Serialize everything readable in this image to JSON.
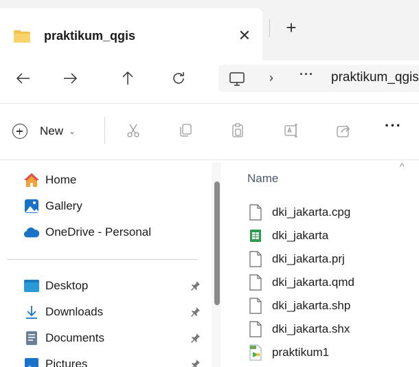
{
  "tab": {
    "title": "praktikum_qgis",
    "close_glyph": "✕",
    "new_tab_glyph": "+"
  },
  "nav": {
    "address_more": "···",
    "address_chevron": "›",
    "breadcrumb": "praktikum_qgis"
  },
  "commandbar": {
    "new_label": "New",
    "new_chevron": "⌄",
    "more_glyph": "···"
  },
  "sidebar": {
    "items": [
      {
        "label": "Home",
        "icon": "home-icon"
      },
      {
        "label": "Gallery",
        "icon": "gallery-icon"
      },
      {
        "label": "OneDrive - Personal",
        "icon": "onedrive-icon"
      },
      {
        "label": "Desktop",
        "icon": "desktop-icon"
      },
      {
        "label": "Downloads",
        "icon": "downloads-icon"
      },
      {
        "label": "Documents",
        "icon": "documents-icon"
      },
      {
        "label": "Pictures",
        "icon": "pictures-icon"
      }
    ]
  },
  "filelist": {
    "column_name": "Name",
    "sort_glyph": "^",
    "files": [
      {
        "name": "dki_jakarta.cpg",
        "icon": "file-icon"
      },
      {
        "name": "dki_jakarta",
        "icon": "spreadsheet-icon"
      },
      {
        "name": "dki_jakarta.prj",
        "icon": "file-icon"
      },
      {
        "name": "dki_jakarta.qmd",
        "icon": "file-icon"
      },
      {
        "name": "dki_jakarta.shp",
        "icon": "file-icon"
      },
      {
        "name": "dki_jakarta.shx",
        "icon": "file-icon"
      },
      {
        "name": "praktikum1",
        "icon": "qgis-project-icon"
      }
    ]
  },
  "colors": {
    "folder": "#f2c14e",
    "accent_blue": "#1a73c9",
    "spreadsheet_green": "#2e9b4e"
  }
}
